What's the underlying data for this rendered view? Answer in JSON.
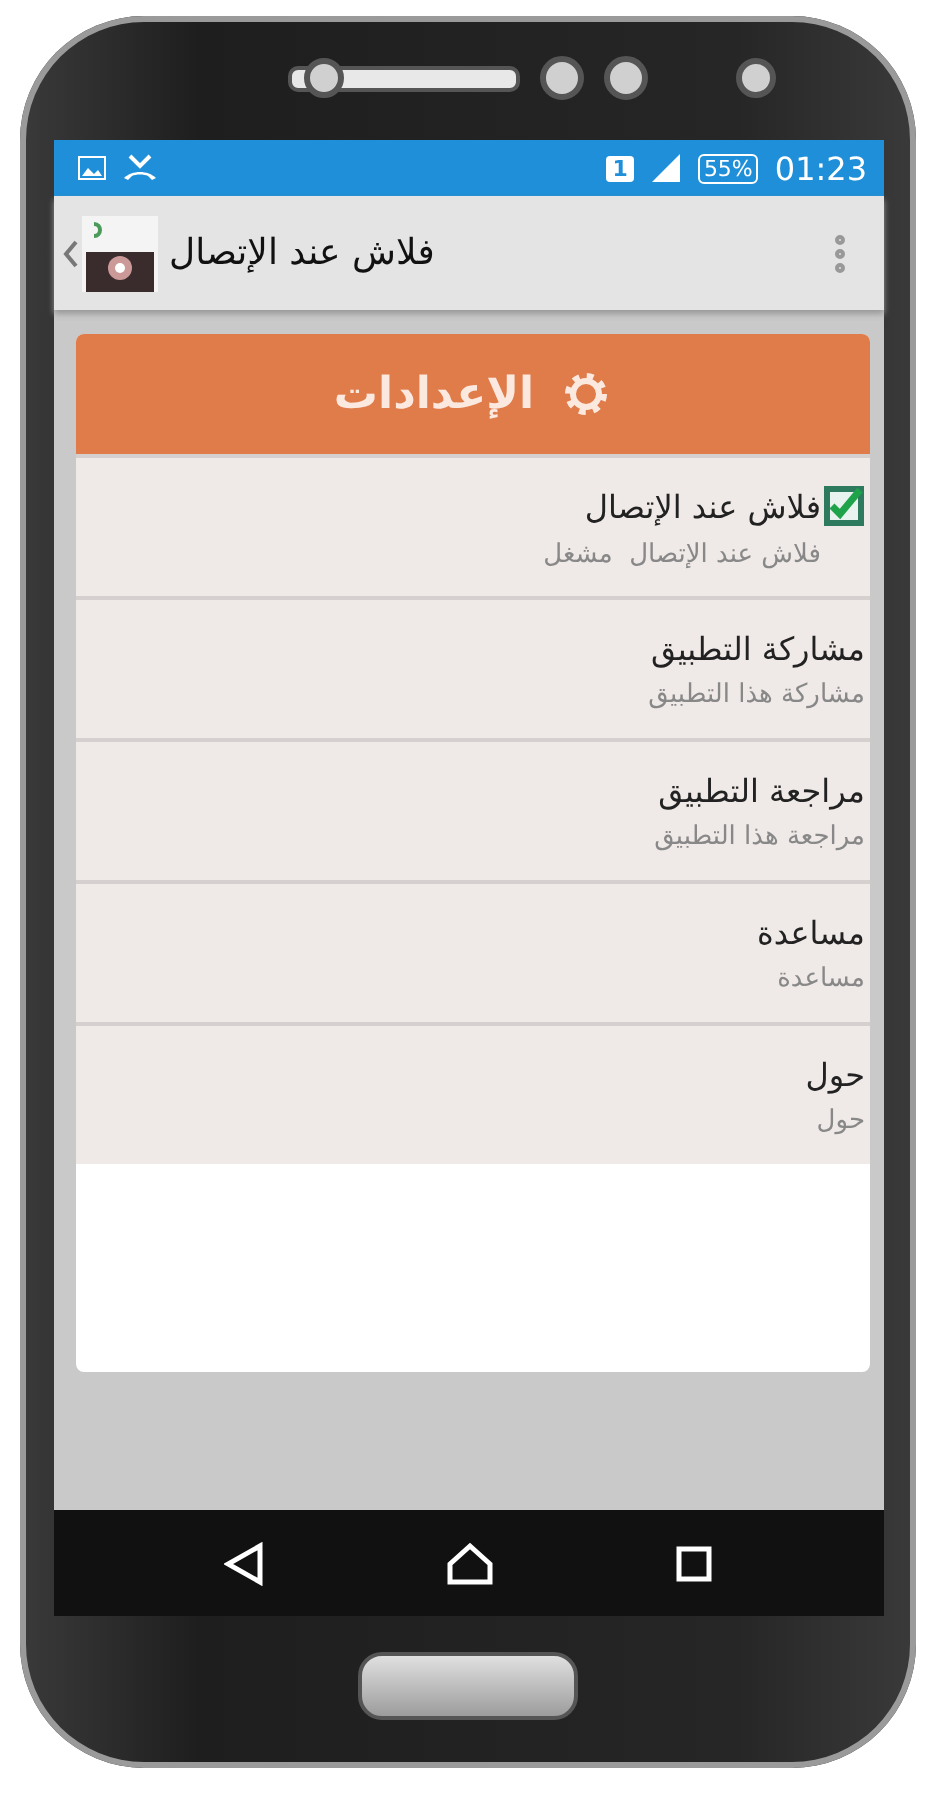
{
  "status_bar": {
    "sim": "1",
    "battery": "55%",
    "time": "01:23"
  },
  "app_bar": {
    "title": "فلاش عند الإتصال"
  },
  "settings": {
    "title": "الإعدادات",
    "items": [
      {
        "kind": "checkbox",
        "title": "فلاش عند الإتصال",
        "summary": "فلاش عند الإتصال  مشغل",
        "checked": true
      },
      {
        "kind": "plain",
        "title": "مشاركة التطبيق",
        "summary": "مشاركة هذا التطبيق"
      },
      {
        "kind": "plain",
        "title": "مراجعة التطبيق",
        "summary": "مراجعة هذا التطبيق"
      },
      {
        "kind": "plain",
        "title": "مساعدة",
        "summary": "مساعدة"
      },
      {
        "kind": "plain",
        "title": "حول",
        "summary": "حول"
      }
    ]
  }
}
